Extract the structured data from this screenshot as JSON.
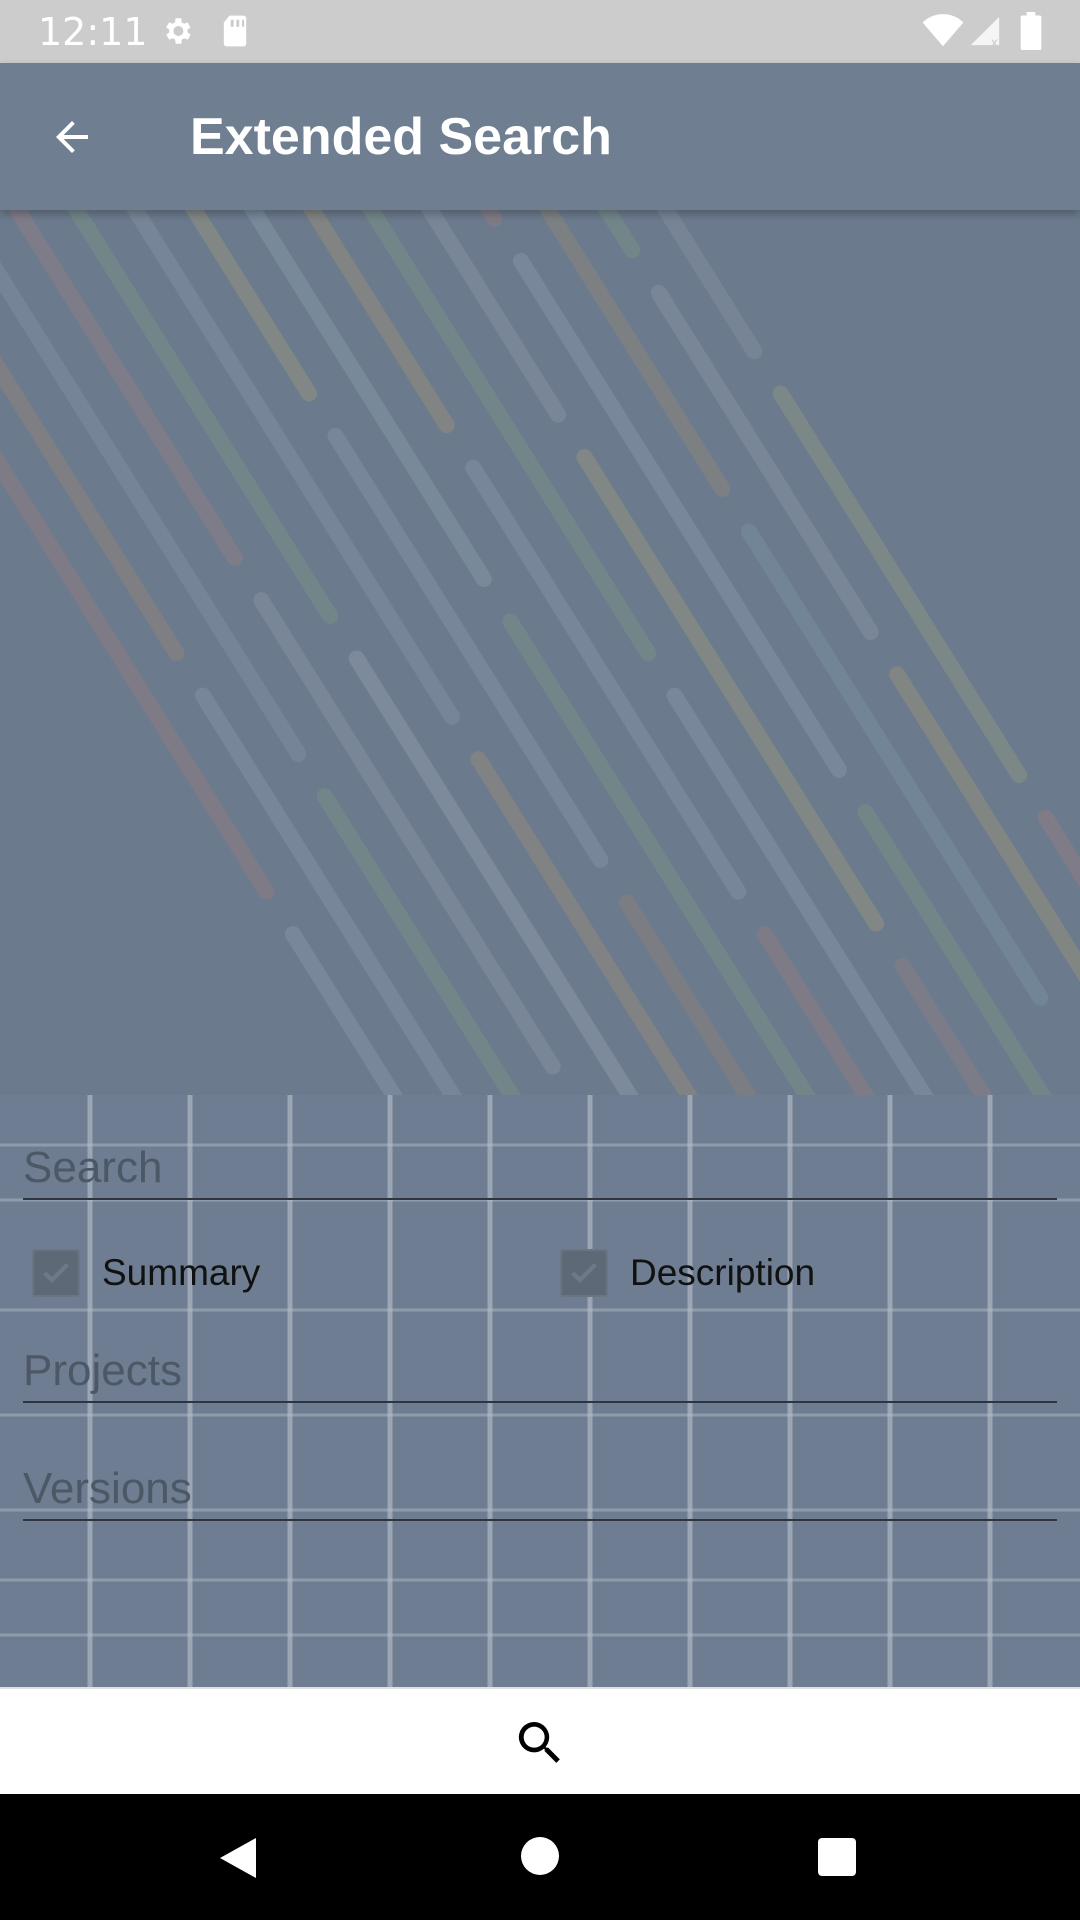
{
  "status_bar": {
    "time": "12:11",
    "icons": [
      "settings-icon",
      "sd-card-icon",
      "wifi-icon",
      "cell-signal-icon",
      "battery-icon"
    ]
  },
  "app_bar": {
    "title": "Extended Search",
    "back_icon": "arrow-left-icon"
  },
  "form": {
    "search_placeholder": "Search",
    "search_value": "",
    "checkboxes": [
      {
        "label": "Summary",
        "checked": true
      },
      {
        "label": "Description",
        "checked": true
      }
    ],
    "projects_placeholder": "Projects",
    "versions_placeholder": "Versions"
  },
  "bottom_bar": {
    "search_icon": "search-icon"
  },
  "nav_bar": {
    "icons": [
      "back-triangle-icon",
      "home-circle-icon",
      "recents-square-icon"
    ]
  },
  "colors": {
    "app_bar": "#6f7f91",
    "form_bg": "#6e7d91",
    "status_bar": "#cccccc"
  }
}
